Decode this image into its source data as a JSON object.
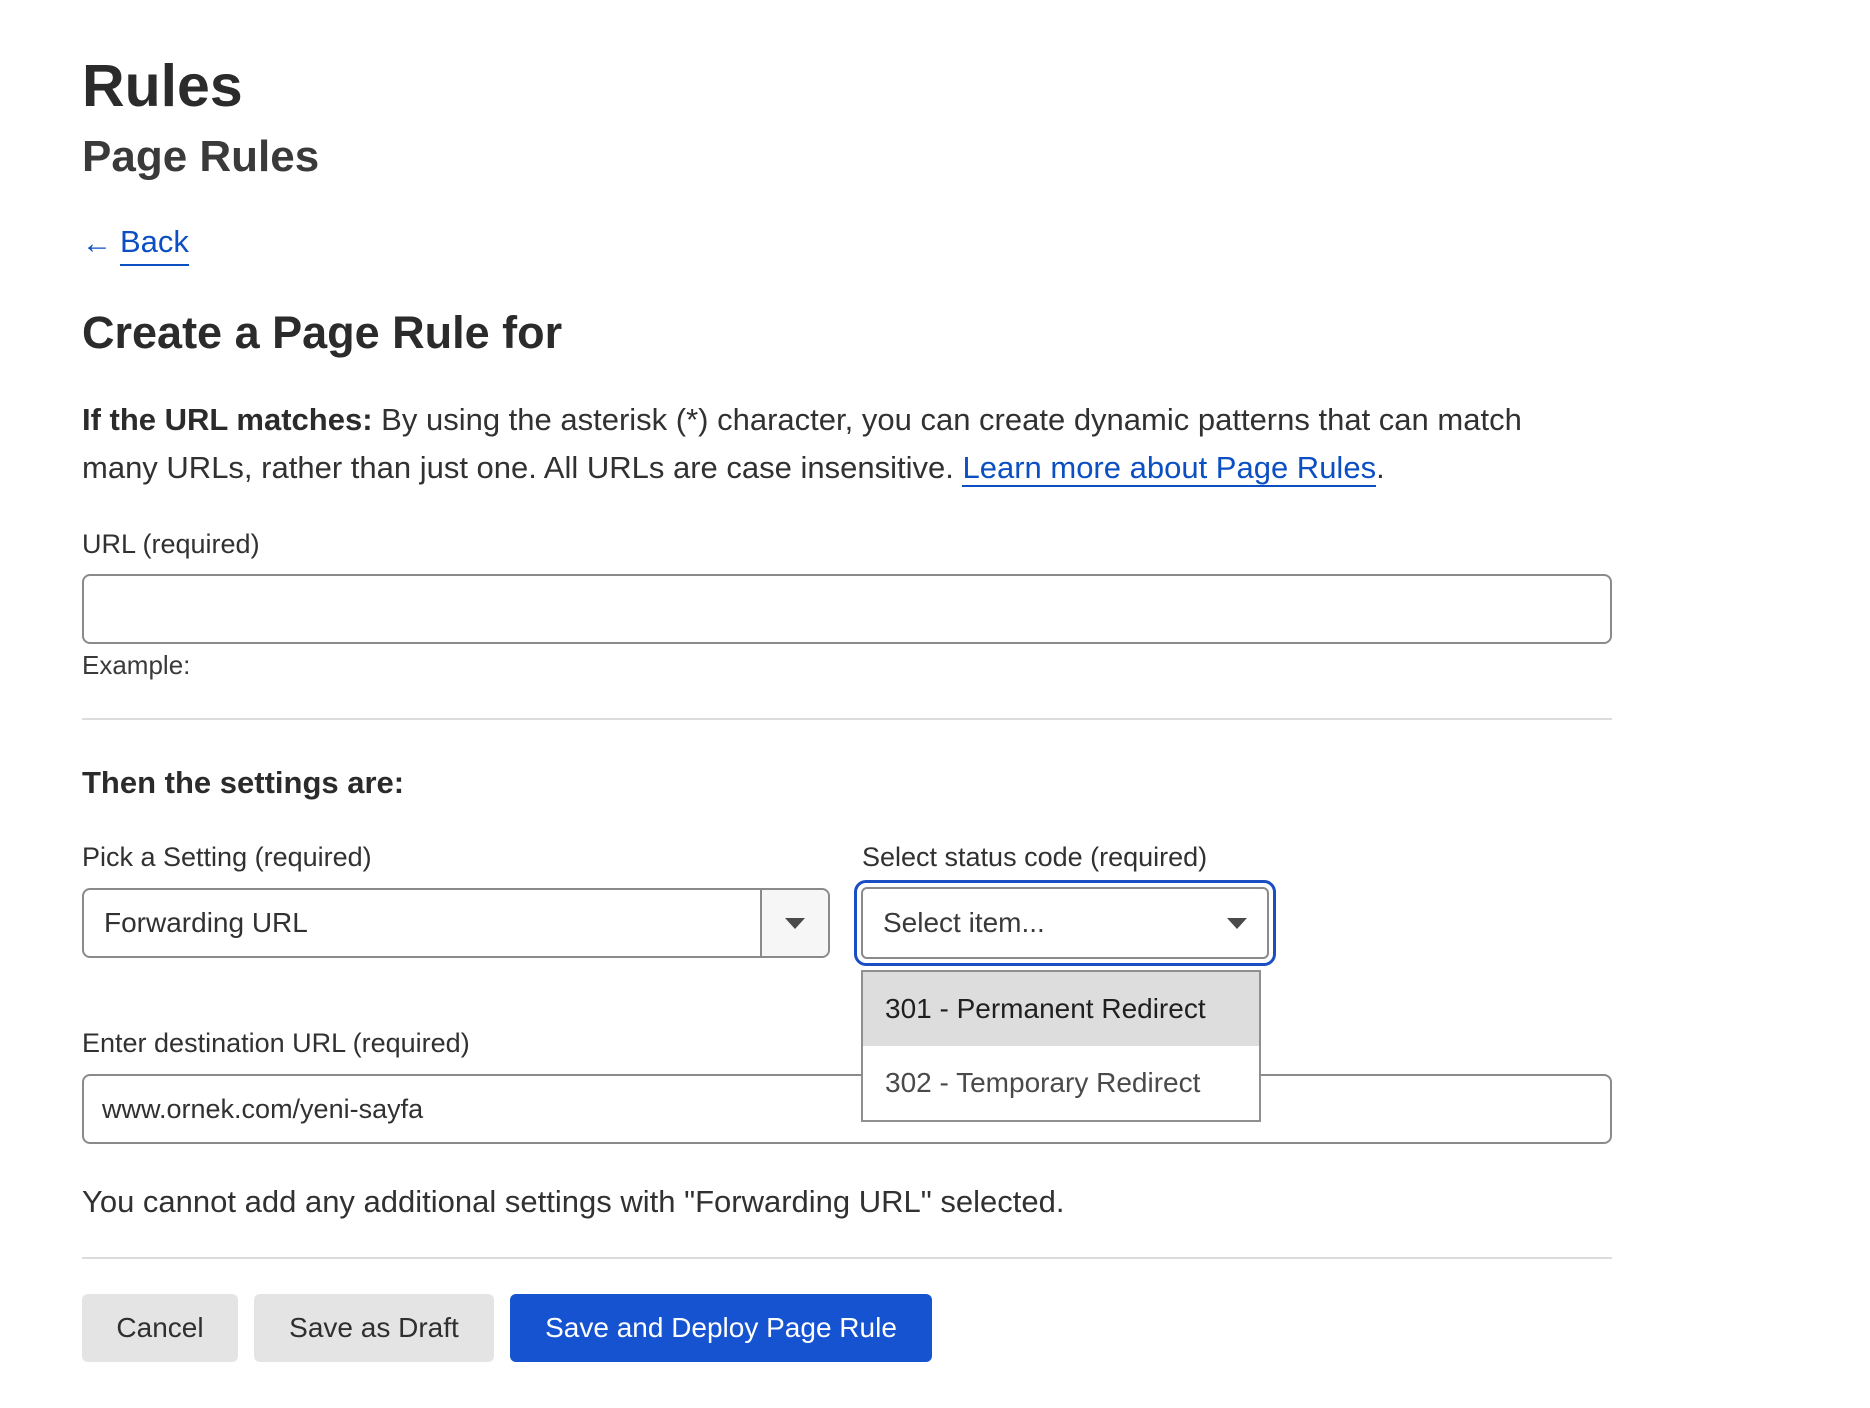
{
  "header": {
    "title": "Rules",
    "subtitle": "Page Rules",
    "back_label": "Back"
  },
  "form": {
    "heading": "Create a Page Rule for",
    "intro_bold": "If the URL matches:",
    "intro_text": " By using the asterisk (*) character, you can create dynamic patterns that can match many URLs, rather than just one. All URLs are case insensitive. ",
    "learn_more_link": "Learn more about Page Rules",
    "intro_end": ".",
    "url_label": "URL (required)",
    "url_value": "",
    "example_label": "Example:",
    "settings_heading": "Then the settings are:",
    "setting_label": "Pick a Setting (required)",
    "setting_value": "Forwarding URL",
    "status_label": "Select status code (required)",
    "status_placeholder": "Select item...",
    "status_options": [
      "301 - Permanent Redirect",
      "302 - Temporary Redirect"
    ],
    "destination_label": "Enter destination URL (required)",
    "destination_value": "www.ornek.com/yeni-sayfa",
    "note": "You cannot add any additional settings with \"Forwarding URL\" selected."
  },
  "actions": {
    "cancel_label": "Cancel",
    "draft_label": "Save as Draft",
    "deploy_label": "Save and Deploy Page Rule"
  },
  "colors": {
    "link": "#0b4fc3",
    "primary_button": "#1553d1",
    "focus_ring": "#1a4fc4",
    "secondary_button": "#e4e4e4"
  }
}
